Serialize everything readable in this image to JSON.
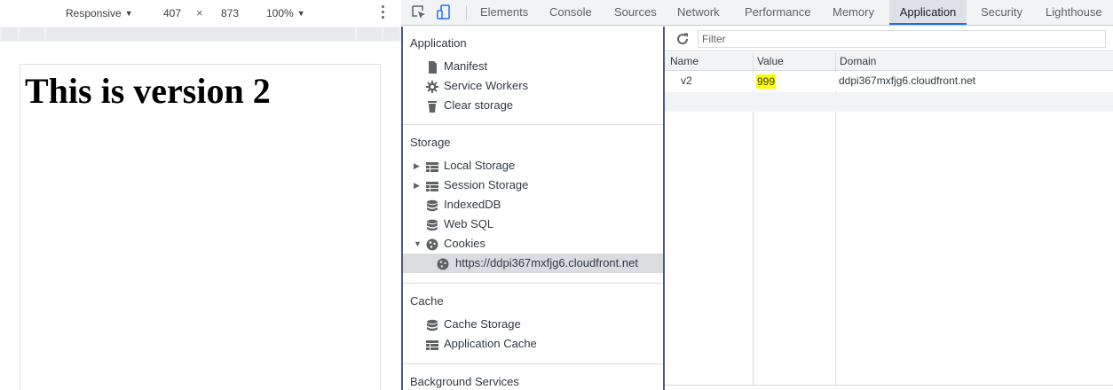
{
  "device_toolbar": {
    "device": "Responsive",
    "width": "407",
    "times": "×",
    "height": "873",
    "zoom": "100%"
  },
  "page": {
    "heading": "This is version 2"
  },
  "devtools": {
    "tabs": [
      "Elements",
      "Console",
      "Sources",
      "Network",
      "Performance",
      "Memory",
      "Application",
      "Security",
      "Lighthouse"
    ],
    "active_tab": "Application"
  },
  "sidebar": {
    "application": {
      "title": "Application",
      "items": [
        "Manifest",
        "Service Workers",
        "Clear storage"
      ]
    },
    "storage": {
      "title": "Storage",
      "items": [
        "Local Storage",
        "Session Storage",
        "IndexedDB",
        "Web SQL",
        "Cookies"
      ],
      "cookie_origin": "https://ddpi367mxfjg6.cloudfront.net"
    },
    "cache": {
      "title": "Cache",
      "items": [
        "Cache Storage",
        "Application Cache"
      ]
    },
    "background_services": {
      "title": "Background Services"
    }
  },
  "cookies_table": {
    "filter_placeholder": "Filter",
    "columns": [
      "Name",
      "Value",
      "Domain"
    ],
    "rows": [
      {
        "name": "v2",
        "value": "999",
        "domain": "ddpi367mxfjg6.cloudfront.net"
      }
    ],
    "highlight_color": "#ffff00"
  },
  "colors": {
    "accent": "#1a73e8",
    "panel_border": "#4a5d7e",
    "selected_row": "#dadce0"
  }
}
